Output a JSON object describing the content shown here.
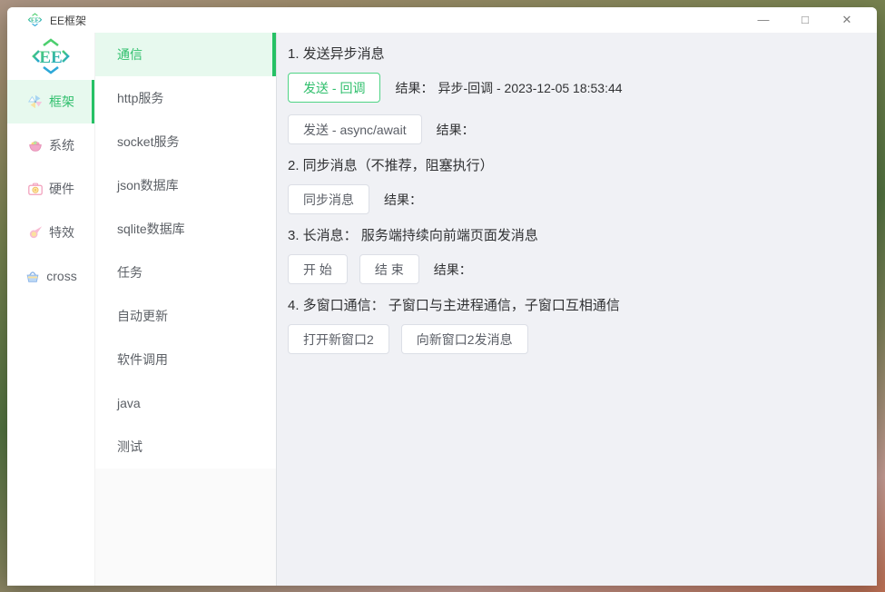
{
  "titlebar": {
    "title": "EE框架",
    "icons": {
      "minimize": "—",
      "maximize": "□",
      "close": "✕"
    }
  },
  "logo": {
    "text": "EE"
  },
  "primary_sidebar": {
    "items": [
      {
        "icon": "pinwheel-icon",
        "label": "框架",
        "selected": true
      },
      {
        "icon": "fruit-basket-icon",
        "label": "系统",
        "selected": false
      },
      {
        "icon": "camera-icon",
        "label": "硬件",
        "selected": false
      },
      {
        "icon": "comet-icon",
        "label": "特效",
        "selected": false
      },
      {
        "icon": "shopping-basket-icon",
        "label": "cross",
        "selected": false
      }
    ]
  },
  "secondary_sidebar": {
    "items": [
      {
        "label": "通信",
        "selected": true
      },
      {
        "label": "http服务",
        "selected": false
      },
      {
        "label": "socket服务",
        "selected": false
      },
      {
        "label": "json数据库",
        "selected": false
      },
      {
        "label": "sqlite数据库",
        "selected": false
      },
      {
        "label": "任务",
        "selected": false
      },
      {
        "label": "自动更新",
        "selected": false
      },
      {
        "label": "软件调用",
        "selected": false
      },
      {
        "label": "java",
        "selected": false
      },
      {
        "label": "测试",
        "selected": false
      }
    ]
  },
  "main": {
    "sections": [
      {
        "title": "1. 发送异步消息",
        "rows": [
          {
            "buttons": [
              {
                "label": "发送 - 回调",
                "style": "success"
              }
            ],
            "result_label": "结果：",
            "result_value": "异步-回调 - 2023-12-05 18:53:44"
          },
          {
            "buttons": [
              {
                "label": "发送 - async/await",
                "style": "default"
              }
            ],
            "result_label": "结果：",
            "result_value": ""
          }
        ]
      },
      {
        "title": "2. 同步消息（不推荐，阻塞执行）",
        "rows": [
          {
            "buttons": [
              {
                "label": "同步消息",
                "style": "default"
              }
            ],
            "result_label": "结果：",
            "result_value": ""
          }
        ]
      },
      {
        "title": "3. 长消息： 服务端持续向前端页面发消息",
        "rows": [
          {
            "buttons": [
              {
                "label": "开 始",
                "style": "default"
              },
              {
                "label": "结 束",
                "style": "default"
              }
            ],
            "result_label": "结果：",
            "result_value": ""
          }
        ]
      },
      {
        "title": "4. 多窗口通信： 子窗口与主进程通信，子窗口互相通信",
        "rows": [
          {
            "buttons": [
              {
                "label": "打开新窗口2",
                "style": "default"
              },
              {
                "label": "向新窗口2发消息",
                "style": "default"
              }
            ],
            "result_label": "",
            "result_value": ""
          }
        ]
      }
    ]
  },
  "colors": {
    "accent_green": "#2fbf6c",
    "accent_green_bar": "#26c165",
    "accent_green_bg": "#e7f9ee",
    "button_border": "#dcdfe6",
    "button_text": "#5a5e66",
    "main_bg": "#f0f1f5",
    "heading_text": "#303133"
  }
}
